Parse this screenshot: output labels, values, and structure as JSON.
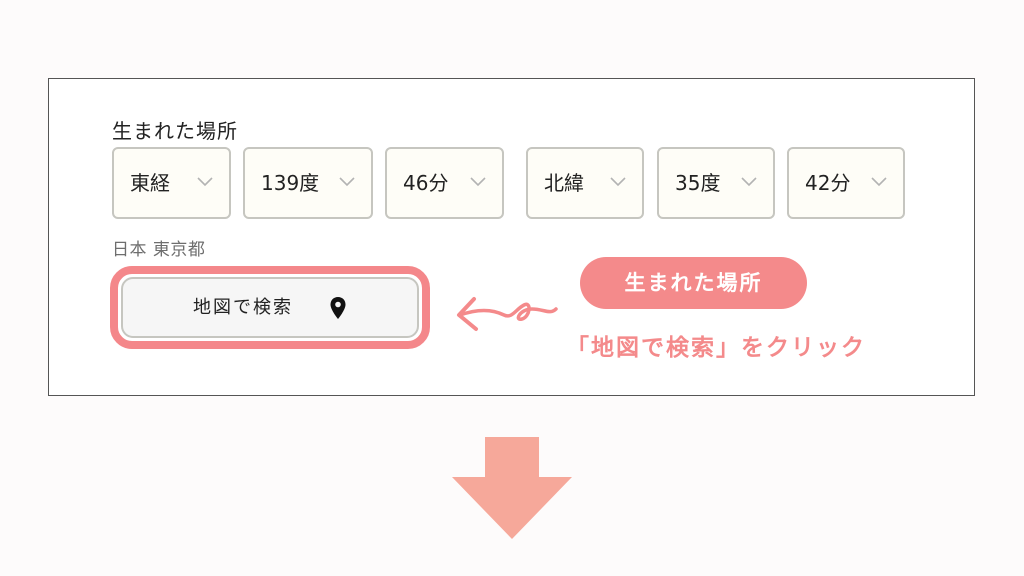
{
  "form": {
    "section_label": "生まれた場所",
    "longitude": {
      "direction": "東経",
      "degrees": "139度",
      "minutes": "46分"
    },
    "latitude": {
      "direction": "北緯",
      "degrees": "35度",
      "minutes": "42分"
    },
    "location_text": "日本 東京都",
    "map_search_button": {
      "label": "地図で検索",
      "icon": "map-pin-icon"
    }
  },
  "annotation": {
    "badge_text": "生まれた場所",
    "instruction_text": "「地図で検索」をクリック",
    "accent_color": "#f48a8b",
    "arrow_icon": "curly-arrow-left-icon"
  },
  "down_arrow": {
    "icon": "down-arrow-icon",
    "color": "#f6a89a"
  }
}
